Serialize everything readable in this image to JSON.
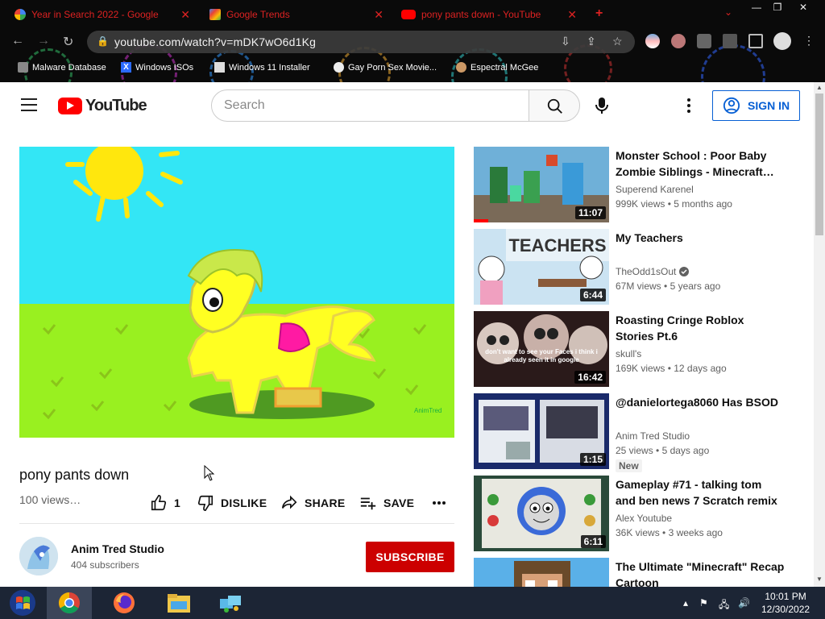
{
  "browser": {
    "tabs": [
      {
        "title": "Year in Search 2022 - Google",
        "favicon": "google-icon"
      },
      {
        "title": "Google Trends",
        "favicon": "google-trends-icon"
      },
      {
        "title": "pony pants down - YouTube",
        "favicon": "youtube-icon",
        "active": true
      }
    ],
    "new_tab": "+",
    "url": "youtube.com/watch?v=mDK7wO6d1Kg",
    "bookmarks": [
      {
        "label": "Malware Database",
        "icon": "folder-icon"
      },
      {
        "label": "Windows ISOs",
        "icon": "x-icon"
      },
      {
        "label": "Windows 11 Installer",
        "icon": "page-icon"
      },
      {
        "label": "Gay Porn Sex Movie...",
        "icon": "site-icon"
      },
      {
        "label": "Espectral McGee",
        "icon": "face-icon"
      }
    ],
    "accent_color": "#dd2222"
  },
  "youtube": {
    "logo_text": "YouTube",
    "search_placeholder": "Search",
    "sign_in": "SIGN IN"
  },
  "video": {
    "title": "pony pants down",
    "views": "100 views…",
    "likes": "1",
    "dislike": "DISLIKE",
    "share": "SHARE",
    "save": "SAVE",
    "channel": "Anim Tred Studio",
    "subscribers": "404 subscribers",
    "subscribe": "SUBSCRIBE",
    "watermark": "AnimTred"
  },
  "recommendations": [
    {
      "title": "Monster School : Poor Baby Zombie Siblings - Minecraft…",
      "channel": "Superend Karenel",
      "views": "999K views",
      "age": "5 months ago",
      "duration": "11:07",
      "verified": false,
      "new": false
    },
    {
      "title": "My Teachers",
      "channel": "TheOdd1sOut",
      "views": "67M views",
      "age": "5 years ago",
      "duration": "6:44",
      "verified": true,
      "new": false,
      "thumb_text": "TEACHERS"
    },
    {
      "title": "Roasting Cringe Roblox Stories Pt.6",
      "channel": "skull's",
      "views": "169K views",
      "age": "12 days ago",
      "duration": "16:42",
      "verified": false,
      "new": false,
      "thumb_text": "don't want to see your Faces i think i already seen it in google"
    },
    {
      "title": "@danielortega8060 Has BSOD",
      "channel": "Anim Tred Studio",
      "views": "25 views",
      "age": "5 days ago",
      "duration": "1:15",
      "verified": false,
      "new": true,
      "badge": "New"
    },
    {
      "title": "Gameplay #71 - talking tom and ben news 7 Scratch remix",
      "channel": "Alex Youtube",
      "views": "36K views",
      "age": "3 weeks ago",
      "duration": "6:11",
      "verified": false,
      "new": false
    },
    {
      "title": "The Ultimate \"Minecraft\" Recap Cartoon",
      "channel": "",
      "views": "",
      "age": "",
      "duration": "",
      "verified": false,
      "new": false
    }
  ],
  "taskbar": {
    "apps": [
      "start-icon",
      "chrome-icon",
      "firefox-icon",
      "file-explorer-icon",
      "network-app-icon"
    ],
    "time": "10:01 PM",
    "date": "12/30/2022"
  }
}
